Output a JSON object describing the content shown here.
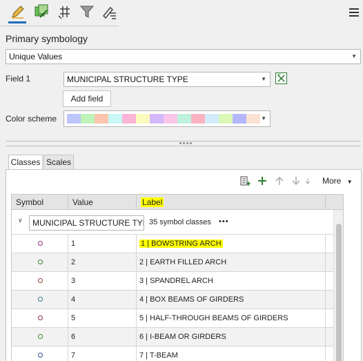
{
  "toolbar": {
    "icons": [
      "primary-symbology-icon",
      "secondary-symbology-icon",
      "vary-symbology-icon",
      "filter-icon",
      "label-class-icon"
    ],
    "menu_icon": "hamburger-menu-icon"
  },
  "primary": {
    "heading": "Primary symbology",
    "renderer_value": "Unique Values"
  },
  "field1": {
    "label": "Field 1",
    "value": "MUNICIPAL STRUCTURE TYPE"
  },
  "add_field_label": "Add field",
  "color_scheme": {
    "label": "Color scheme",
    "swatches": [
      "#bcc6fb",
      "#bff4b8",
      "#fbc6ad",
      "#c9f8f6",
      "#f9b4d6",
      "#fbfbbd",
      "#d4b8fa",
      "#f9c5e9",
      "#bdf2de",
      "#f9b3c0",
      "#d2ecfc",
      "#dcf8b6",
      "#b4b7fb",
      "#fbe2d2"
    ]
  },
  "tabs": [
    "Classes",
    "Scales"
  ],
  "tools": {
    "more_label": "More"
  },
  "table": {
    "headers": {
      "symbol": "Symbol",
      "value": "Value",
      "label": "Label"
    },
    "group": {
      "name": "MUNICIPAL STRUCTURE TYPE",
      "count_text": "35 symbol classes",
      "more_glyph": "•••"
    },
    "rows": [
      {
        "value": "1",
        "label": "1 | BOWSTRING ARCH",
        "color": "#8a2d8a",
        "highlight": true
      },
      {
        "value": "2",
        "label": "2 | EARTH FILLED ARCH",
        "color": "#2e7d32",
        "highlight": false
      },
      {
        "value": "3",
        "label": "3 | SPANDREL ARCH",
        "color": "#8a3d2d",
        "highlight": false
      },
      {
        "value": "4",
        "label": "4 | BOX BEAMS OF GIRDERS",
        "color": "#2d6d7a",
        "highlight": false
      },
      {
        "value": "5",
        "label": "5 | HALF-THROUGH BEAMS OF GIRDERS",
        "color": "#8a2d4d",
        "highlight": false
      },
      {
        "value": "6",
        "label": "6 | I-BEAM OR GIRDERS",
        "color": "#3d7a2d",
        "highlight": false
      },
      {
        "value": "7",
        "label": "7 | T-BEAM",
        "color": "#2d4d8a",
        "highlight": false
      }
    ]
  }
}
